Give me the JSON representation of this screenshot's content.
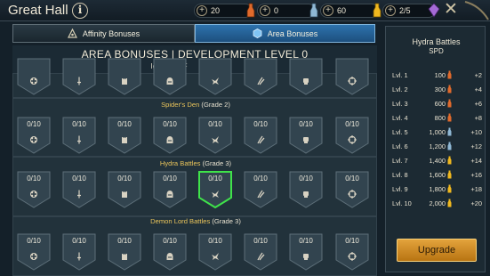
{
  "header": {
    "title": "Great Hall",
    "info_icon_label": "i",
    "resources": [
      {
        "value": "20",
        "icon": "potion-orange-icon",
        "color": "#e06a2c"
      },
      {
        "value": "0",
        "icon": "potion-blue-icon",
        "color": "#8fb8d4"
      },
      {
        "value": "60",
        "icon": "potion-yellow-icon",
        "color": "#f0b81f"
      },
      {
        "value": "2/5",
        "icon": "gem-purple-icon",
        "color": "#a56ad6"
      }
    ],
    "close_icon": "close-icon"
  },
  "tabs": [
    {
      "label": "Affinity Bonuses",
      "icon": "affinity-triangle-icon",
      "active": false
    },
    {
      "label": "Area Bonuses",
      "icon": "area-gem-icon",
      "active": true
    }
  ],
  "main": {
    "heading": "AREA BONUSES | DEVELOPMENT LEVEL 0",
    "columns": [
      "HP",
      "ATK",
      "DEF",
      "Ignore DEF",
      "SPD",
      "C. DMG",
      "RES",
      "ACC"
    ],
    "sections": [
      {
        "name": "",
        "grade": "",
        "values": [
          "",
          "",
          "",
          "",
          "",
          "",
          "",
          ""
        ]
      },
      {
        "name": "Spider's Den",
        "grade": "(Grade 2)",
        "values": [
          "0/10",
          "0/10",
          "0/10",
          "0/10",
          "0/10",
          "0/10",
          "0/10",
          "0/10"
        ]
      },
      {
        "name": "Hydra Battles",
        "grade": "(Grade 3)",
        "values": [
          "0/10",
          "0/10",
          "0/10",
          "0/10",
          "0/10",
          "0/10",
          "0/10",
          "0/10"
        ],
        "selected_index": 4
      },
      {
        "name": "Demon Lord Battles",
        "grade": "(Grade 3)",
        "values": [
          "0/10",
          "0/10",
          "0/10",
          "0/10",
          "0/10",
          "0/10",
          "0/10",
          "0/10"
        ]
      }
    ],
    "stat_icons": [
      "hp-cross-icon",
      "atk-sword-icon",
      "def-tower-icon",
      "ignore-def-helmet-icon",
      "spd-bird-icon",
      "cdmg-claw-icon",
      "res-fist-icon",
      "acc-target-icon"
    ]
  },
  "panel": {
    "title": "Hydra Battles",
    "subtitle": "SPD",
    "levels": [
      {
        "level": "Lvl. 1",
        "cost": "100",
        "bonus": "+2",
        "potion": "orange"
      },
      {
        "level": "Lvl. 2",
        "cost": "300",
        "bonus": "+4",
        "potion": "orange"
      },
      {
        "level": "Lvl. 3",
        "cost": "600",
        "bonus": "+6",
        "potion": "orange"
      },
      {
        "level": "Lvl. 4",
        "cost": "800",
        "bonus": "+8",
        "potion": "orange"
      },
      {
        "level": "Lvl. 5",
        "cost": "1,000",
        "bonus": "+10",
        "potion": "blue"
      },
      {
        "level": "Lvl. 6",
        "cost": "1,200",
        "bonus": "+12",
        "potion": "blue"
      },
      {
        "level": "Lvl. 7",
        "cost": "1,400",
        "bonus": "+14",
        "potion": "yellow"
      },
      {
        "level": "Lvl. 8",
        "cost": "1,600",
        "bonus": "+16",
        "potion": "yellow"
      },
      {
        "level": "Lvl. 9",
        "cost": "1,800",
        "bonus": "+18",
        "potion": "yellow"
      },
      {
        "level": "Lvl. 10",
        "cost": "2,000",
        "bonus": "+20",
        "potion": "yellow"
      }
    ],
    "upgrade_label": "Upgrade"
  },
  "colors": {
    "accent_gold": "#e9c45b",
    "active_tab": "#2d73ad",
    "selected_outline": "#3fe34a",
    "upgrade_button": "#d28f2a"
  }
}
